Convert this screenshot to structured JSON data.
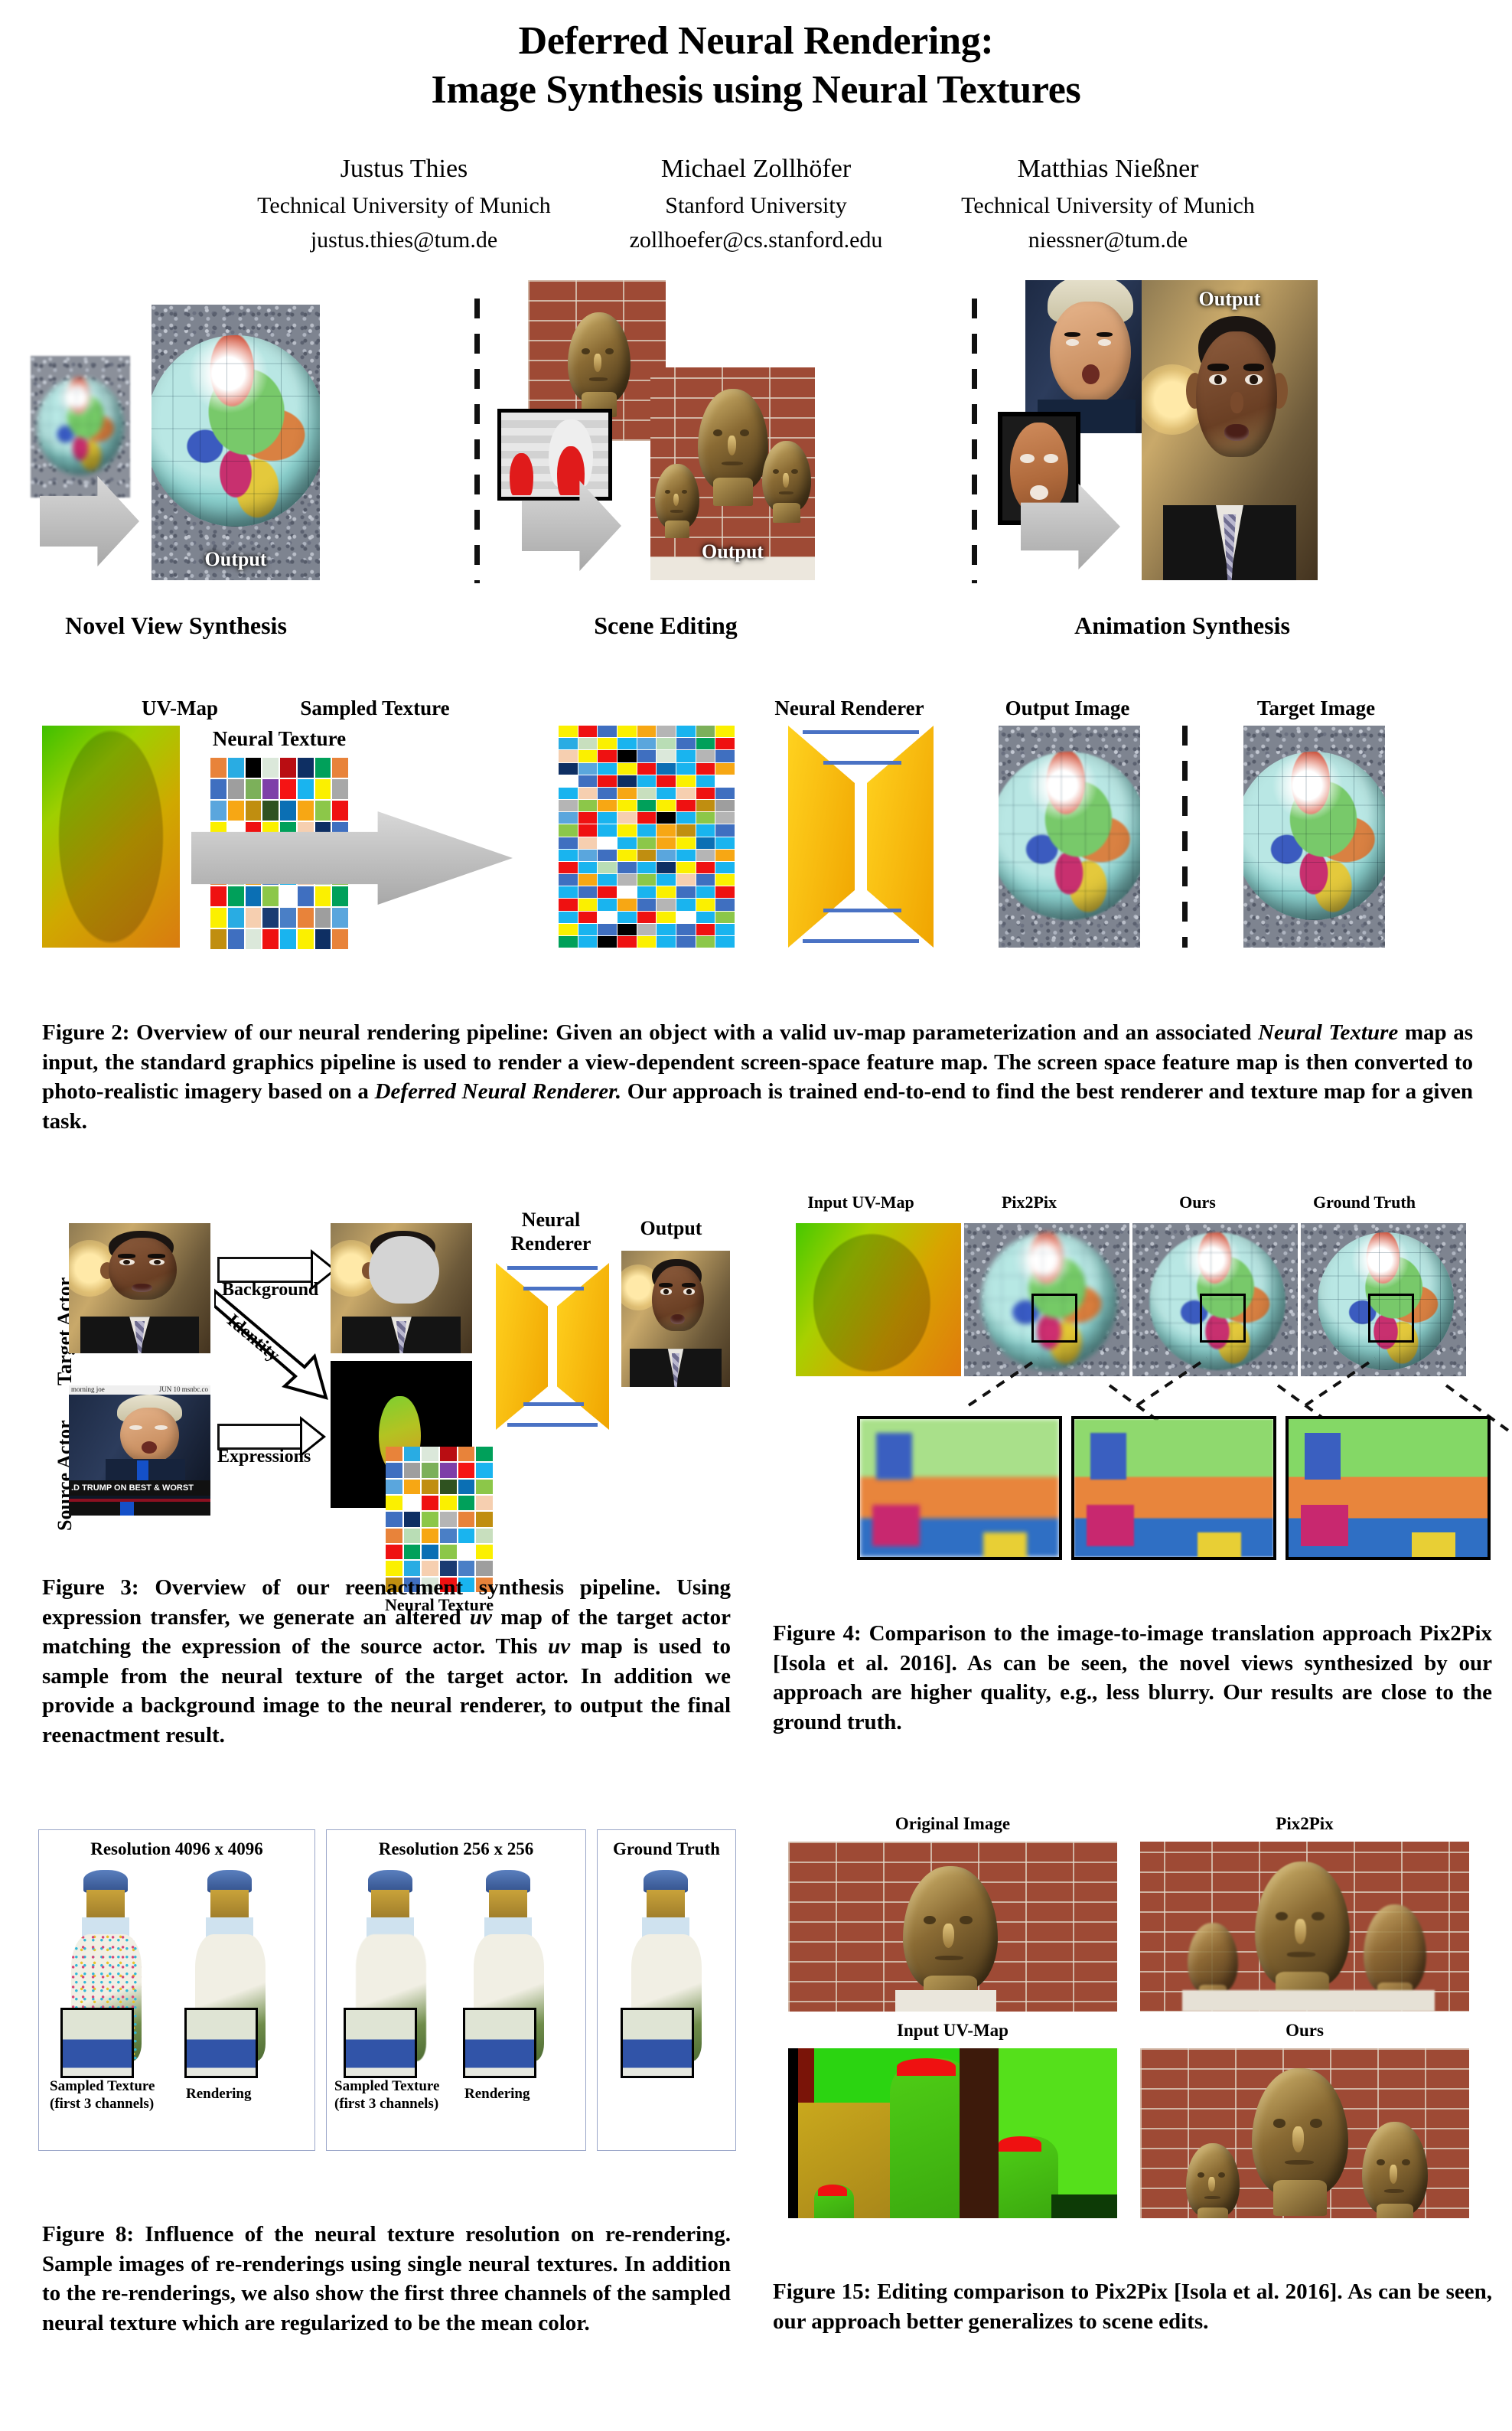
{
  "paper": {
    "title_line1": "Deferred Neural Rendering:",
    "title_line2": "Image Synthesis using Neural Textures"
  },
  "authors": [
    {
      "name": "Justus Thies",
      "affiliation": "Technical University of Munich",
      "email": "justus.thies@tum.de"
    },
    {
      "name": "Michael Zollhöfer",
      "affiliation": "Stanford University",
      "email": "zollhoefer@cs.stanford.edu"
    },
    {
      "name": "Matthias Nießner",
      "affiliation": "Technical University of Munich",
      "email": "niessner@tum.de"
    }
  ],
  "teaser": {
    "panels": [
      {
        "caption": "Novel View Synthesis",
        "output_label": "Output"
      },
      {
        "caption": "Scene Editing",
        "output_label": "Output"
      },
      {
        "caption": "Animation Synthesis",
        "output_label": "Output"
      }
    ]
  },
  "figure2": {
    "labels": {
      "uv_map": "UV-Map",
      "neural_texture": "Neural Texture",
      "sampled_texture": "Sampled Texture",
      "neural_renderer": "Neural Renderer",
      "output_image": "Output Image",
      "target_image": "Target Image"
    },
    "caption_parts": [
      "Figure 2: Overview of our neural rendering pipeline: Given an object with a valid uv-map parameterization and an associated ",
      "Neural Texture",
      " map as input, the standard graphics pipeline is used to render a view-dependent screen-space feature map. The screen space feature map is then converted to photo-realistic imagery based on a ",
      "Deferred Neural Renderer.",
      " Our approach is trained end-to-end to find the best renderer and texture map for a given task."
    ]
  },
  "figure3": {
    "labels": {
      "target_actor": "Target Actor",
      "source_actor": "Source Actor",
      "background": "Background",
      "identity": "Identity",
      "expressions": "Expressions",
      "neural_renderer_l1": "Neural",
      "neural_renderer_l2": "Renderer",
      "output": "Output",
      "neural_texture": "Neural Texture",
      "chyron_left": "morning joe",
      "chyron_right": "JUN 10   msnbc.co",
      "ticker": ".D TRUMP ON BEST & WORST PRESI"
    },
    "caption_parts": [
      "Figure 3:  Overview of our reenactment synthesis pipeline. Using expression transfer, we generate an altered ",
      "uv",
      " map of the target actor matching the expression of the source actor. This ",
      "uv",
      " map is used to sample from the neural texture of the target actor.  In addition we provide a background image to the neural renderer, to output the final reenactment result."
    ]
  },
  "figure4": {
    "columns": [
      "Input UV-Map",
      "Pix2Pix",
      "Ours",
      "Ground Truth"
    ],
    "caption": "Figure 4: Comparison to the image-to-image translation approach Pix2Pix [Isola et al. 2016]. As can be seen, the novel views synthesized by our approach are higher quality, e.g., less blurry. Our results are close to the ground truth."
  },
  "figure8": {
    "panels": [
      {
        "header": "Resolution 4096 x 4096",
        "sub_left_l1": "Sampled Texture",
        "sub_left_l2": "(first 3 channels)",
        "sub_right": "Rendering"
      },
      {
        "header": "Resolution 256 x 256",
        "sub_left_l1": "Sampled Texture",
        "sub_left_l2": "(first 3 channels)",
        "sub_right": "Rendering"
      },
      {
        "header": "Ground Truth",
        "sub_left_l1": "",
        "sub_left_l2": "",
        "sub_right": ""
      }
    ],
    "caption": "Figure 8:  Influence of the neural texture resolution on re-rendering. Sample images of re-renderings using single neural textures. In addition to the re-renderings, we also show the first three channels of the sampled neural texture which are regularized to be the mean color."
  },
  "figure15": {
    "quadrants": [
      "Original Image",
      "Pix2Pix",
      "Input UV-Map",
      "Ours"
    ],
    "caption": "Figure 15: Editing comparison to Pix2Pix [Isola et al. 2016]. As can be seen, our approach better generalizes to scene edits."
  },
  "colors": {
    "renderer_yellow": "#ffd21f",
    "renderer_yellow_dark": "#f0a400",
    "renderer_line_blue": "#4a72c4",
    "arrow_gray": "#c2c2c2",
    "uv_green": "#3ec000",
    "uv_orange": "#d97b10",
    "brick_red": "#9e4a35",
    "bronze": "#8a6b34"
  },
  "neural_texture_grid": {
    "cols": 8,
    "rows": 9,
    "cells": [
      "#e8833a",
      "#29ace3",
      "#000000",
      "#dbe8da",
      "#b90d12",
      "#0e2f63",
      "#00a05a",
      "#e8833a",
      "#3f6fc0",
      "#9e9e9e",
      "#7cb05a",
      "#7e3fa8",
      "#f51414",
      "#19b4ef",
      "#fbf000",
      "#a8a8a8",
      "#5aa6dd",
      "#f7a714",
      "#c08e10",
      "#2f5220",
      "#0b6fb4",
      "#f7a714",
      "#8cc749",
      "#ef1111",
      "#fbf000",
      "#ffffff",
      "#ef1111",
      "#fbf000",
      "#00a05a",
      "#f6cfb0",
      "#0e2f63",
      "#3f6fc0",
      "#3f6fc0",
      "#0e2f63",
      "#8cc749",
      "#b5b5b5",
      "#e8833a",
      "#4a7fc6",
      "#c08e10",
      "#19b4ef",
      "#e8833a",
      "#b9ddb5",
      "#f7a714",
      "#4a7fc6",
      "#19b4ef",
      "#f6cfb0",
      "#c8dfbe",
      "#8cc749",
      "#ef1111",
      "#00a05a",
      "#0b6fb4",
      "#8cc749",
      "#ffffff",
      "#3f6fc0",
      "#fbf000",
      "#00a05a",
      "#fbf000",
      "#29ace3",
      "#f6cfb0",
      "#1a3b72",
      "#4a7fc6",
      "#e8833a",
      "#9e9e9e",
      "#5aa6dd",
      "#c08e10",
      "#3f6fc0",
      "#dbe8da",
      "#ef1111",
      "#19b4ef",
      "#fbf000",
      "#0e2f63",
      "#e8833a"
    ]
  },
  "sampled_texture_grid": {
    "cols": 9,
    "rows": 18,
    "cells": [
      "#fbf000",
      "#ef1111",
      "#3f6fc0",
      "#fbf000",
      "#f7a714",
      "#b5b5b5",
      "#19b4ef",
      "#7cb05a",
      "#fbf000",
      "#29ace3",
      "#c8dfbe",
      "#fbf000",
      "#19b4ef",
      "#5aa6dd",
      "#b9ddb5",
      "#3f6fc0",
      "#00a05a",
      "#ef1111",
      "#f6cfb0",
      "#fbf000",
      "#ef1111",
      "#000000",
      "#3f6fc0",
      "#dbe8da",
      "#19b4ef",
      "#b5b5b5",
      "#3f6fc0",
      "#0e2f63",
      "#5aa6dd",
      "#19b4ef",
      "#fbf000",
      "#ef1111",
      "#0b6fb4",
      "#19b4ef",
      "#ef1111",
      "#f7a714",
      "#ffffff",
      "#3f6fc0",
      "#ef1111",
      "#0e2f63",
      "#19b4ef",
      "#ef1111",
      "#fbf000",
      "#19b4ef",
      "#ffffff",
      "#19b4ef",
      "#f6cfb0",
      "#3f6fc0",
      "#f7a714",
      "#c8dfbe",
      "#19b4ef",
      "#f6cfb0",
      "#ef1111",
      "#3f6fc0",
      "#b5b5b5",
      "#8cc749",
      "#f7a714",
      "#fbf000",
      "#00a05a",
      "#fbf000",
      "#ef1111",
      "#c08e10",
      "#9e9e9e",
      "#5aa6dd",
      "#ef1111",
      "#19b4ef",
      "#f6cfb0",
      "#ef1111",
      "#000000",
      "#19b4ef",
      "#8cc749",
      "#b5b5b5",
      "#8cc749",
      "#ef1111",
      "#19b4ef",
      "#fbf000",
      "#19b4ef",
      "#f7a714",
      "#c08e10",
      "#19b4ef",
      "#3f6fc0",
      "#3f6fc0",
      "#f6cfb0",
      "#ffffff",
      "#19b4ef",
      "#8cc749",
      "#f7a714",
      "#fbf000",
      "#0b6fb4",
      "#19b4ef",
      "#19b4ef",
      "#5aa6dd",
      "#3f6fc0",
      "#fbf000",
      "#c08e10",
      "#5aa6dd",
      "#19b4ef",
      "#b5b5b5",
      "#f7a714",
      "#ef1111",
      "#19b4ef",
      "#b9ddb5",
      "#3f6fc0",
      "#19b4ef",
      "#0e2f63",
      "#fbf000",
      "#ef1111",
      "#19b4ef",
      "#3f6fc0",
      "#f7a714",
      "#19b4ef",
      "#b5b5b5",
      "#8cc749",
      "#19b4ef",
      "#f6cfb0",
      "#3f6fc0",
      "#fbf000",
      "#19b4ef",
      "#3f6fc0",
      "#ef1111",
      "#ffffff",
      "#19b4ef",
      "#fbf000",
      "#3f6fc0",
      "#19b4ef",
      "#ef1111",
      "#ef1111",
      "#fbf000",
      "#19b4ef",
      "#f7a714",
      "#3f6fc0",
      "#b5b5b5",
      "#19b4ef",
      "#fbf000",
      "#3f6fc0",
      "#19b4ef",
      "#ef1111",
      "#ffffff",
      "#19b4ef",
      "#ef1111",
      "#fbf000",
      "#ffffff",
      "#19b4ef",
      "#8cc749",
      "#fbf000",
      "#19b4ef",
      "#3f6fc0",
      "#000000",
      "#b5b5b5",
      "#19b4ef",
      "#3f6fc0",
      "#ef1111",
      "#19b4ef",
      "#00a05a",
      "#19b4ef",
      "#000000",
      "#ef1111",
      "#fbf000",
      "#19b4ef",
      "#3f6fc0",
      "#8cc749",
      "#19b4ef"
    ]
  },
  "figure3_texture_grid": {
    "cols": 6,
    "rows": 9,
    "cells": [
      "#e8833a",
      "#29ace3",
      "#dbe8da",
      "#b90d12",
      "#e8833a",
      "#00a05a",
      "#3f6fc0",
      "#9e9e9e",
      "#7cb05a",
      "#7e3fa8",
      "#f51414",
      "#19b4ef",
      "#5aa6dd",
      "#f7a714",
      "#c08e10",
      "#2f5220",
      "#0b6fb4",
      "#8cc749",
      "#fbf000",
      "#ffffff",
      "#ef1111",
      "#fbf000",
      "#00a05a",
      "#f6cfb0",
      "#3f6fc0",
      "#0e2f63",
      "#8cc749",
      "#b5b5b5",
      "#e8833a",
      "#c08e10",
      "#e8833a",
      "#b9ddb5",
      "#f7a714",
      "#4a7fc6",
      "#19b4ef",
      "#c8dfbe",
      "#ef1111",
      "#00a05a",
      "#0b6fb4",
      "#8cc749",
      "#ffffff",
      "#fbf000",
      "#fbf000",
      "#29ace3",
      "#f6cfb0",
      "#1a3b72",
      "#4a7fc6",
      "#9e9e9e",
      "#c08e10",
      "#3f6fc0",
      "#dbe8da",
      "#ef1111",
      "#19b4ef",
      "#e8833a"
    ]
  }
}
